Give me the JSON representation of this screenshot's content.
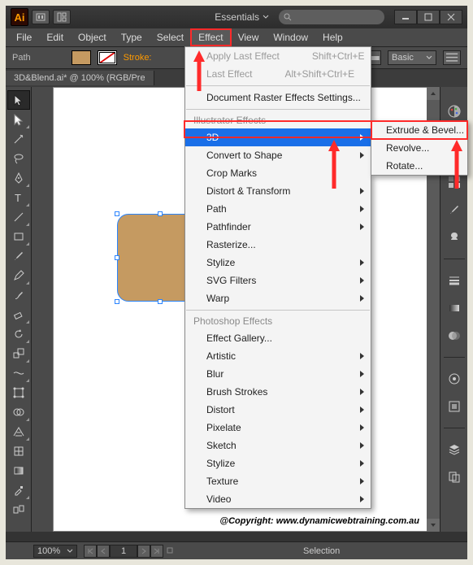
{
  "titlebar": {
    "logo": "Ai",
    "essentials_label": "Essentials"
  },
  "menubar": {
    "items": [
      "File",
      "Edit",
      "Object",
      "Type",
      "Select",
      "Effect",
      "View",
      "Window",
      "Help"
    ]
  },
  "controlbar": {
    "path_label": "Path",
    "stroke_label": "Stroke:",
    "basic_label": "Basic"
  },
  "doctab": {
    "title": "3D&Blend.ai* @ 100% (RGB/Pre"
  },
  "effect_menu": {
    "apply_last": "Apply Last Effect",
    "apply_last_sc": "Shift+Ctrl+E",
    "last": "Last Effect",
    "last_sc": "Alt+Shift+Ctrl+E",
    "doc_raster": "Document Raster Effects Settings...",
    "section_ill": "Illustrator Effects",
    "ill_items": [
      "3D",
      "Convert to Shape",
      "Crop Marks",
      "Distort & Transform",
      "Path",
      "Pathfinder",
      "Rasterize...",
      "Stylize",
      "SVG Filters",
      "Warp"
    ],
    "section_ps": "Photoshop Effects",
    "ps_items": [
      "Effect Gallery...",
      "Artistic",
      "Blur",
      "Brush Strokes",
      "Distort",
      "Pixelate",
      "Sketch",
      "Stylize",
      "Texture",
      "Video"
    ]
  },
  "sub3d": {
    "items": [
      "Extrude & Bevel...",
      "Revolve...",
      "Rotate..."
    ]
  },
  "statusbar": {
    "zoom": "100%",
    "page": "1",
    "selection": "Selection"
  },
  "copyright": "@Copyright: www.dynamicwebtraining.com.au"
}
